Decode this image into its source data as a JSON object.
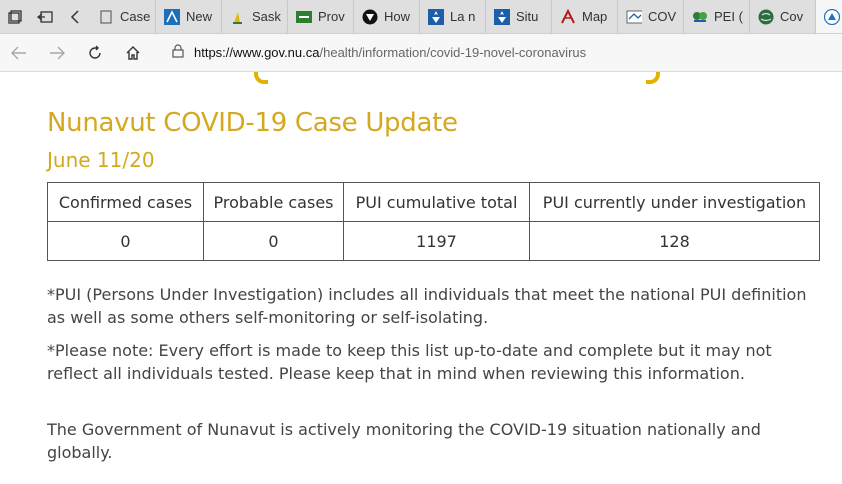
{
  "browser": {
    "tabs": [
      {
        "title": "Case",
        "icon": "page-icon",
        "color": "#555555"
      },
      {
        "title": "New",
        "icon": "new-brunswick-icon",
        "color": "#1c6fb8"
      },
      {
        "title": "Sask",
        "icon": "saskatchewan-icon",
        "color": "#e3b600"
      },
      {
        "title": "Prov",
        "icon": "manitoba-icon",
        "color": "#2e7d32"
      },
      {
        "title": "How",
        "icon": "ontario-icon",
        "color": "#222222"
      },
      {
        "title": "La n",
        "icon": "quebec-icon",
        "color": "#1c5ea8"
      },
      {
        "title": "Situ",
        "icon": "quebec-icon",
        "color": "#1c5ea8"
      },
      {
        "title": "Map",
        "icon": "nova-scotia-icon",
        "color": "#b71c1c"
      },
      {
        "title": "COV",
        "icon": "newfoundland-icon",
        "color": "#555555"
      },
      {
        "title": "PEI (",
        "icon": "pei-icon",
        "color": "#2e7d32"
      },
      {
        "title": "Cov",
        "icon": "globe-icon",
        "color": "#2e6b3e"
      },
      {
        "title": "",
        "icon": "nunavut-icon",
        "color": "#1a73c8"
      }
    ],
    "url_host": "https://www.gov.nu.ca",
    "url_path": "/health/information/covid-19-novel-coronavirus"
  },
  "page": {
    "heading": "Nunavut COVID-19 Case Update",
    "subheading": "June 11/20",
    "accent_color": "#d4a81f",
    "table": {
      "headers": [
        "Confirmed cases",
        "Probable cases",
        "PUI cumulative total",
        "PUI currently under investigation"
      ],
      "row": [
        "0",
        "0",
        "1197",
        "128"
      ]
    },
    "note1": "*PUI (Persons Under Investigation) includes all individuals that meet the national PUI definition as well as some others self-monitoring or self-isolating.",
    "note2": "*Please note: Every effort is made to keep this list up-to-date and complete but it may not reflect all individuals tested. Please keep that in mind when reviewing this information.",
    "para": "The Government of Nunavut is actively monitoring the COVID-19 situation nationally and globally."
  }
}
